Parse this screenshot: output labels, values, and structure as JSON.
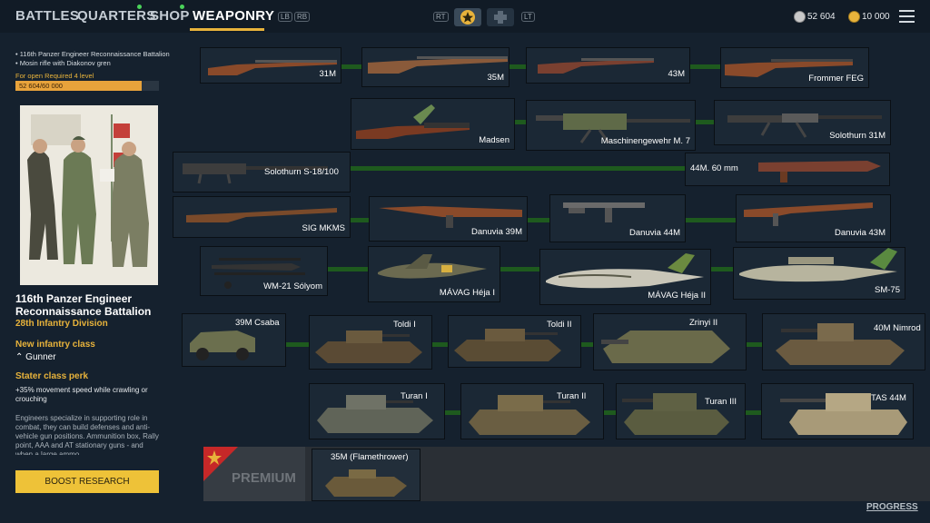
{
  "nav": {
    "battles": "BATTLES",
    "quarters": "QUARTERS",
    "shop": "SHOP",
    "weaponry": "WEAPONRY",
    "lb": "LB",
    "rb": "RB",
    "rt": "RT",
    "lt": "LT"
  },
  "currency": {
    "silver": "52 604",
    "gold": "10 000"
  },
  "left_panel": {
    "note1": "• 116th Panzer Engineer Reconnaissance Battalion",
    "note2": "• Mosin rifle with Diakonov gren",
    "requirement": "For open Required 4 level",
    "progress_text": "52 604/60 000",
    "progress_fraction": 0.877,
    "unit_name": "116th Panzer Engineer Reconnaissance Battalion",
    "division": "28th Infantry Division",
    "new_class_label": "New infantry class",
    "class_name": "Gunner",
    "perk_label": "Stater class perk",
    "perk_text": "+35% movement speed while crawling or crouching",
    "description": "Engineers specialize in supporting role in combat, they can build defenses and anti-vehicle gun positions. Ammunition box, Rally point, AAA and AT stationary guns - and when a large ammo",
    "boost_button": "BOOST RESEARCH"
  },
  "tree": {
    "items": [
      {
        "name": "31M",
        "kind": "rifle"
      },
      {
        "name": "35M",
        "kind": "rifle"
      },
      {
        "name": "43M",
        "kind": "rifle"
      },
      {
        "name": "Frommer FEG",
        "kind": "rifle"
      },
      {
        "name": "Madsen",
        "kind": "lmg"
      },
      {
        "name": "Maschinengewehr M. 7",
        "kind": "mg"
      },
      {
        "name": "Solothurn 31M",
        "kind": "mg"
      },
      {
        "name": "Solothurn S-18/100",
        "kind": "atr"
      },
      {
        "name": "44M. 60 mm",
        "kind": "launcher"
      },
      {
        "name": "SIG MKMS",
        "kind": "smg"
      },
      {
        "name": "Danuvia 39M",
        "kind": "smg"
      },
      {
        "name": "Danuvia 44M",
        "kind": "smg"
      },
      {
        "name": "Danuvia 43M",
        "kind": "smg"
      },
      {
        "name": "WM-21 Sólyom",
        "kind": "biplane"
      },
      {
        "name": "MÁVAG Héja I",
        "kind": "fighter"
      },
      {
        "name": "MÁVAG Héja II",
        "kind": "fighter"
      },
      {
        "name": "SM-75",
        "kind": "bomber"
      },
      {
        "name": "39M Csaba",
        "kind": "car"
      },
      {
        "name": "Toldi I",
        "kind": "tank"
      },
      {
        "name": "Toldi II",
        "kind": "tank"
      },
      {
        "name": "Zrinyi II",
        "kind": "tank"
      },
      {
        "name": "40M Nimrod",
        "kind": "tank"
      },
      {
        "name": "Turan I",
        "kind": "tank"
      },
      {
        "name": "Turan II",
        "kind": "tank"
      },
      {
        "name": "Turan III",
        "kind": "tank"
      },
      {
        "name": "TAS 44M",
        "kind": "tank"
      }
    ]
  },
  "premium": {
    "label": "PREMIUM",
    "item": "35M (Flamethrower)"
  },
  "progress_link": "PROGRESS",
  "colors": {
    "accent": "#e8b33b",
    "background": "#15212e",
    "connector": "#1e5a1e"
  }
}
